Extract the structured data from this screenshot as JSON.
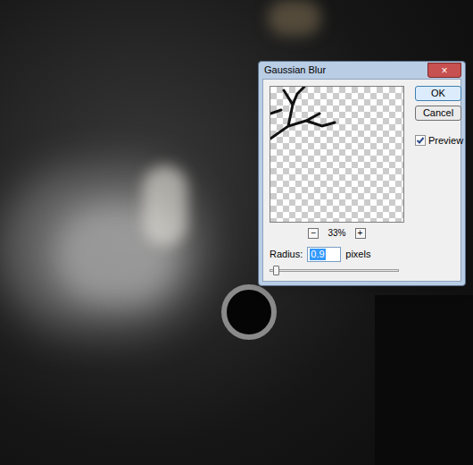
{
  "dialog": {
    "title": "Gaussian Blur",
    "close": "×",
    "zoom_out": "−",
    "zoom": "33%",
    "zoom_in": "+",
    "radius_label": "Radius:",
    "radius_value": "0.9",
    "unit": "pixels",
    "slider": {
      "level": 0.04
    },
    "buttons": [
      "OK",
      "Cancel"
    ],
    "preview": {
      "label": "Preview",
      "checked": true
    }
  }
}
